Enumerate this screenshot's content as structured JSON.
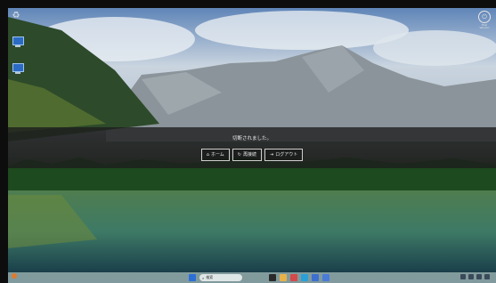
{
  "desktop": {
    "icons": [
      {
        "label": ""
      },
      {
        "label": ""
      }
    ],
    "top_right_label": "Trial Version"
  },
  "overlay": {
    "message": "切断されました。",
    "buttons": [
      {
        "icon": "home-icon",
        "label": "ホーム"
      },
      {
        "icon": "reconnect-icon",
        "label": "再接続"
      },
      {
        "icon": "logout-icon",
        "label": "ログアウト"
      }
    ]
  },
  "taskbar": {
    "search_placeholder": "検索",
    "weather_text": "",
    "clock_time": "",
    "clock_date": ""
  },
  "colors": {
    "overlay_band": "#1c1c1c",
    "start_button": "#2b6fd6",
    "weather_icon": "#e07a2e"
  }
}
